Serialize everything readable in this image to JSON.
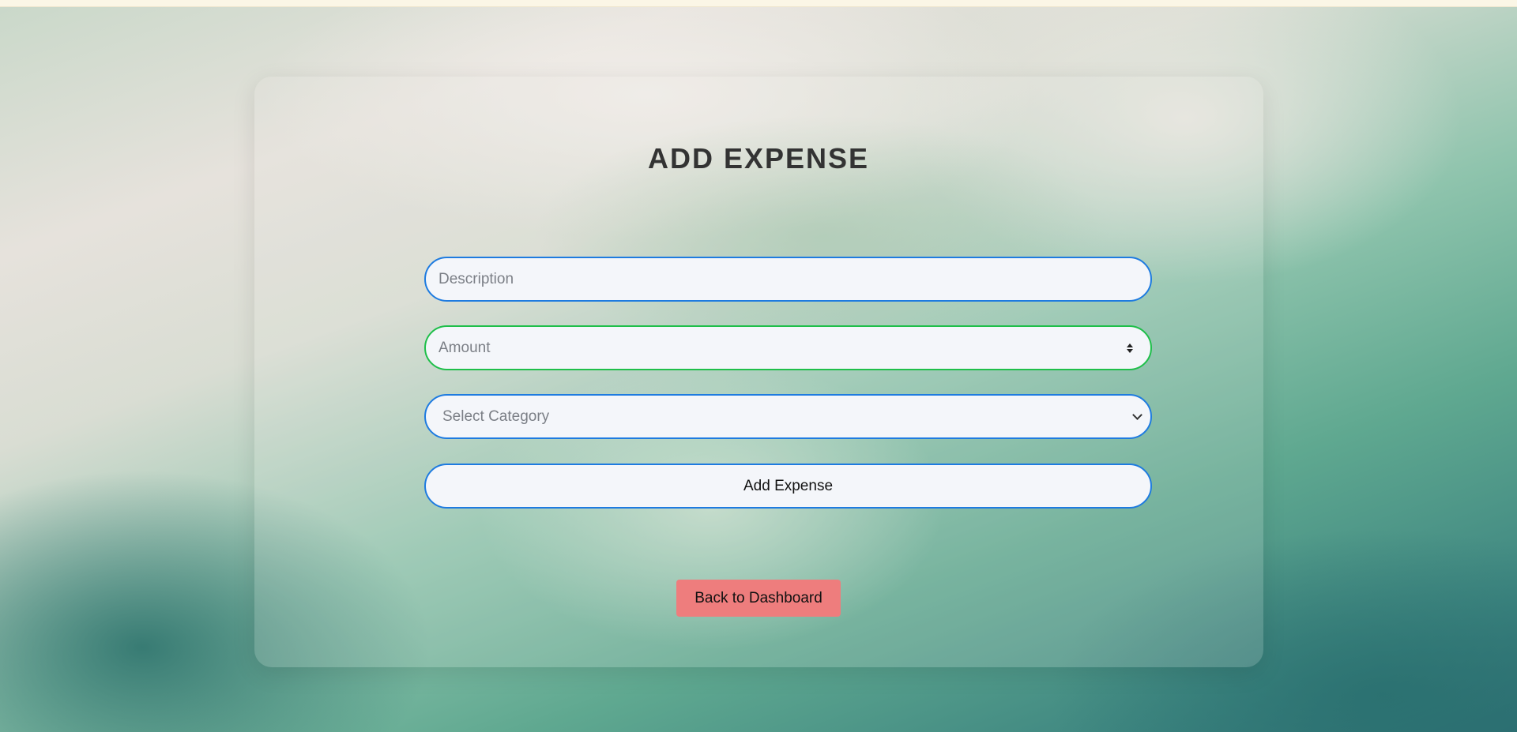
{
  "page": {
    "title": "ADD EXPENSE"
  },
  "form": {
    "description_placeholder": "Description",
    "description_value": "",
    "amount_placeholder": "Amount",
    "amount_value": "",
    "category_selected": "Select Category",
    "submit_label": "Add Expense"
  },
  "nav": {
    "back_label": "Back to Dashboard"
  },
  "colors": {
    "input_border": "#1e7be0",
    "amount_border_focused": "#1fbf4a",
    "back_button": "#ee7d7d",
    "title": "#333333"
  },
  "icons": {
    "amount_spinner": "spinner-icon",
    "category_dropdown": "chevron-down-icon"
  }
}
